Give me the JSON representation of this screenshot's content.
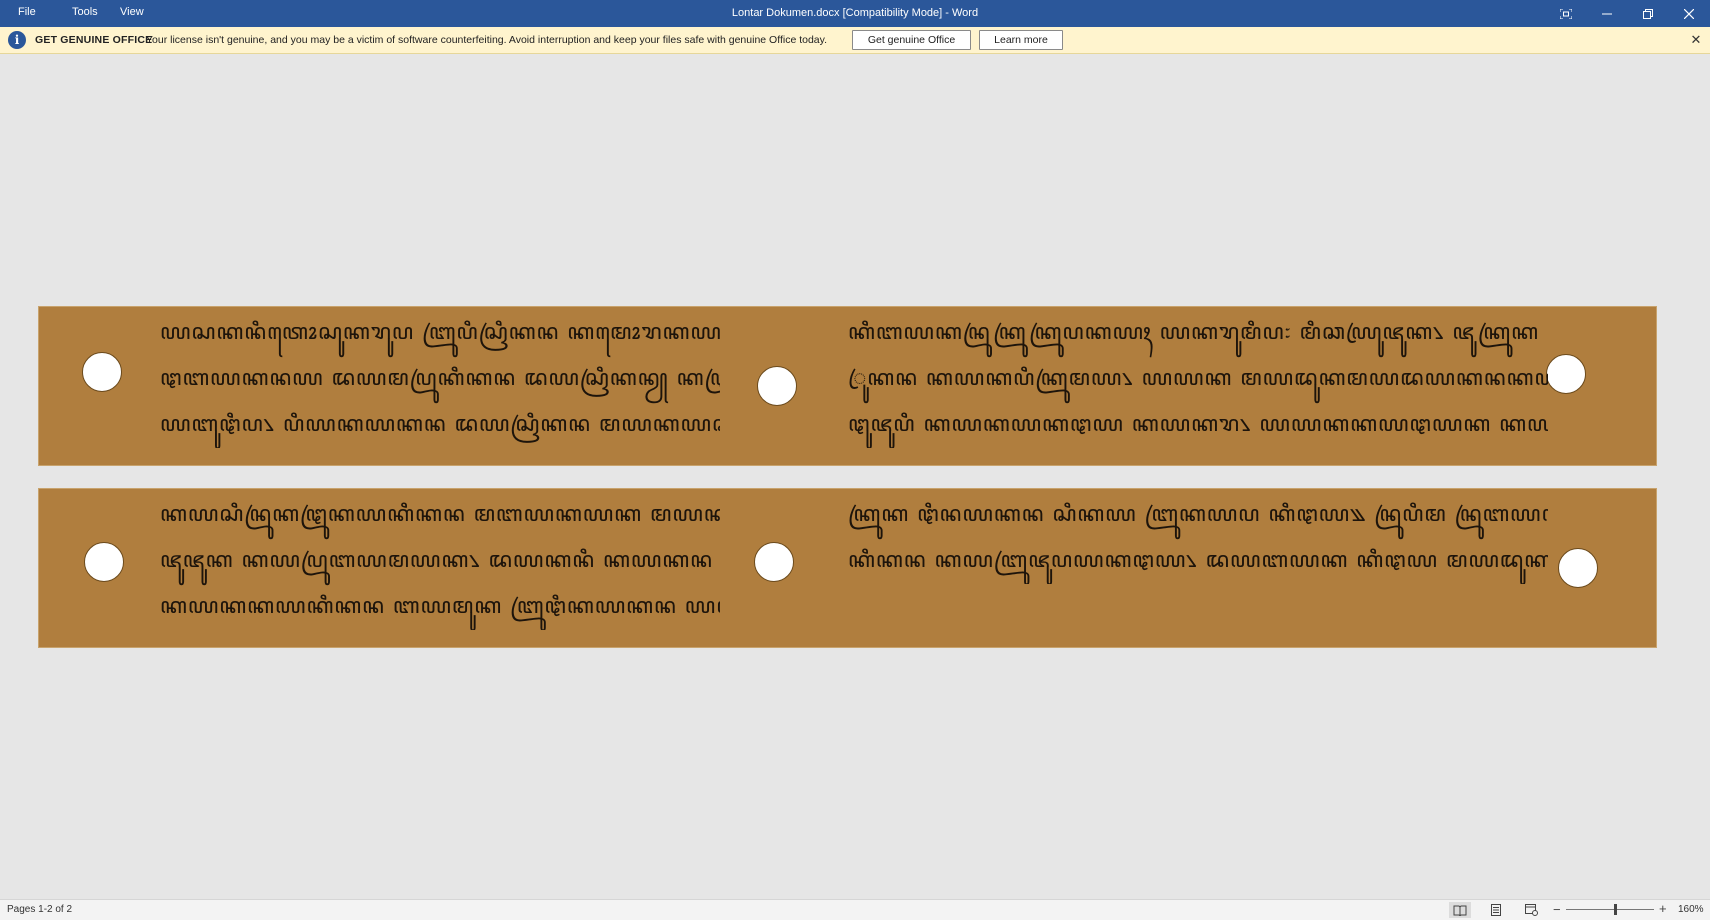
{
  "menu": {
    "file": "File",
    "tools": "Tools",
    "view": "View"
  },
  "window": {
    "title": "Lontar Dokumen.docx [Compatibility Mode]  -  Word"
  },
  "license_bar": {
    "heading": "GET GENUINE OFFICE",
    "message": "Your license isn't genuine, and you may be a victim of software counterfeiting. Avoid interruption and keep your files safe with genuine Office today.",
    "get_button": "Get genuine Office",
    "learn_button": "Learn more"
  },
  "leaves": [
    {
      "left_lines": [
        "ꦪꦱꦏꦤꦶꦠꦺꦴꦱꦸꦏꦫꦸꦥ ꦧꦿꦸꦥꦶꦱꦿꦶꦏꦤ ꦏꦩꦺꦴꦫꦏꦪꦏ ꦧꦪꦛꦿꦶꦏꦛꦪ꧈",
        "ꦛꦧꦪꦏꦤꦪ ꦢꦪꦩꦥꦿꦸꦏꦶꦏꦤ ꦢꦪꦱꦿꦶꦏꦤꦾ ꦏꦛꦿꦸꦏ꧈ ꦗꦸꦗꦸꦕꦤꦶꦧꦪꦏ",
        "ꦪꦧꦸꦛꦶꦥ꧈ ꦥꦶꦪꦏꦪꦏꦤ ꦢꦪꦱꦿꦶꦏꦤ ꦩꦪꦏꦪꦕꦪ ꦮꦧꦪꦏꦛꦪ꧈"
      ],
      "right_lines": [
        "ꦏꦶꦧꦪꦏꦤꦿꦸꦏꦿꦸꦏꦿꦸꦥꦏꦪꦃ ꦪꦏꦫꦸꦩꦶꦥ꧇ ꦩꦶꦕꦪꦿꦸꦗꦸꦏ꧈ ꦗꦸꦏꦿꦸꦏ ꦛꦮꦪꦏ",
        "ꦿꦸꦏꦤ ꦏꦪꦏꦥꦶꦏꦿꦸꦩꦪ꧈ ꦪꦪꦏ ꦩꦪꦢꦸꦏꦩꦪꦢꦪꦏꦤꦏꦪꦏꦪ꧈ ꦢꦛꦾꦏꦾꦩ",
        "ꦛꦸꦗꦸꦥꦶ ꦏꦪꦏꦪꦏꦛꦪ ꦏꦪꦏꦫ꧈ ꦪꦪꦏꦏꦪꦛꦪꦏ ꦏꦪꦏꦿꦸꦏꦤꦧꦪ ꦏꦿꦸꦏꦛꦪ"
      ]
    },
    {
      "left_lines": [
        "ꦏꦪꦱꦶꦤꦿꦸꦏꦛꦿꦸꦏꦪꦏꦶꦏꦤ ꦩꦧꦪꦏꦪꦏ ꦩꦪꦏꦪꦏꦪ꧈ ꦢꦪꦩꦿꦸꦏꦤ",
        "ꦗꦸꦗꦸꦏ ꦏꦪꦥꦿꦸꦧꦪꦩꦪꦏ꧈ ꦢꦪꦏꦤꦶ ꦏꦪꦏꦤ ꦩꦧꦪꦏꦏꦪ ꦩꦪ",
        "ꦏꦪꦏꦏꦪꦏꦶꦏꦤ ꦧꦪꦩꦸꦏ ꦧꦿꦸꦛꦶꦏꦪꦏꦤ ꦪꦛꦢꦪ꧉"
      ],
      "right_lines": [
        "ꦏꦿꦸꦏ ꦛꦶꦤꦪꦏꦤ ꦱꦶꦏꦪ ꦧꦿꦸꦏꦪꦥ ꦏꦶꦛꦪ꧉ ꦤꦿꦸꦥꦶꦩ ꦤꦿꦸꦧꦪꦏ ꦏꦪꦏꦪꦏꦶꦏꦤ",
        "ꦏꦶꦏꦤ ꦏꦪꦧꦿꦸꦗꦸꦥꦪꦏꦛꦪ꧈ ꦢꦪꦧꦪꦏ ꦏꦶꦛꦪ ꦩꦪꦢꦸꦏ ꦛꦪꦛꦪꦩ"
      ]
    }
  ],
  "status": {
    "pages": "Pages 1-2 of 2",
    "zoom": "160%"
  },
  "icons": {
    "info": "info-icon",
    "focus": "focus-mode-icon",
    "minimize": "minimize-icon",
    "restore": "restore-icon",
    "close": "close-icon",
    "read": "read-mode-icon",
    "print": "print-layout-icon",
    "web": "web-layout-icon"
  },
  "colors": {
    "title_bar": "#2b579a",
    "license_bar": "#fff4ce",
    "leaf": "#b07e3e"
  }
}
